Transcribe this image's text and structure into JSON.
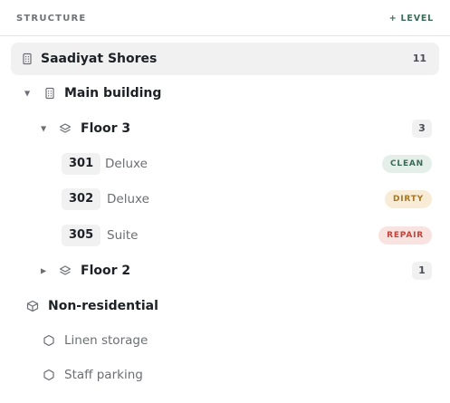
{
  "header": {
    "title": "STRUCTURE",
    "add_label": "+ LEVEL"
  },
  "property": {
    "name": "Saadiyat Shores",
    "count": "11"
  },
  "building": {
    "name": "Main building"
  },
  "floor3": {
    "name": "Floor 3",
    "count": "3"
  },
  "rooms": [
    {
      "number": "301",
      "type": "Deluxe",
      "status": "CLEAN"
    },
    {
      "number": "302",
      "type": "Deluxe",
      "status": "DIRTY"
    },
    {
      "number": "305",
      "type": "Suite",
      "status": "REPAIR"
    }
  ],
  "floor2": {
    "name": "Floor 2",
    "count": "1"
  },
  "nonres": {
    "name": "Non-residential",
    "items": [
      {
        "label": "Linen storage"
      },
      {
        "label": "Staff parking"
      }
    ]
  },
  "colors": {
    "clean": "#3a6b57",
    "dirty": "#a67621",
    "repair": "#c0443b",
    "accent": "#3b6d5a"
  }
}
